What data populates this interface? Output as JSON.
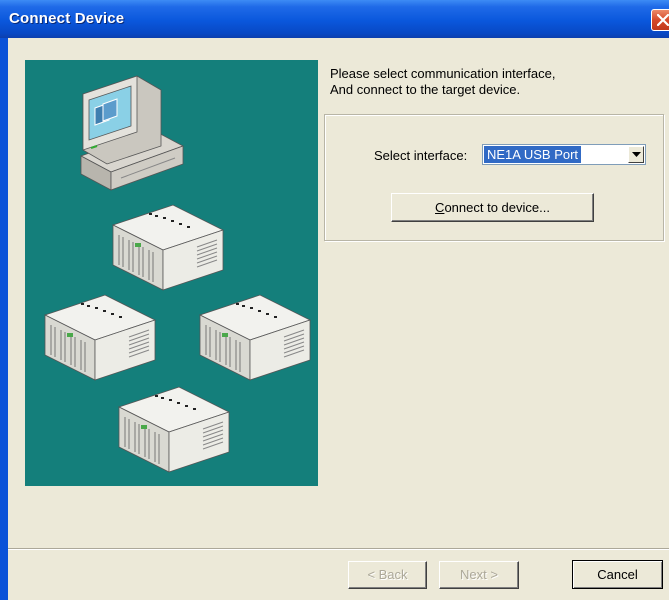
{
  "window": {
    "title": "Connect Device"
  },
  "instructions": {
    "line1": "Please select communication interface,",
    "line2": "And connect to the target device."
  },
  "interface": {
    "label": "Select interface:",
    "selected": "NE1A USB Port"
  },
  "buttons": {
    "connect_pre": "",
    "connect_mnemonic": "C",
    "connect_rest": "onnect to device...",
    "back": "< Back",
    "next": "Next >",
    "cancel": "Cancel"
  },
  "colors": {
    "title_bar": "#0a57dc",
    "dialog_face": "#ece9d8",
    "illustration_bg": "#147f7b",
    "selection": "#316ac5",
    "close_button": "#d6492a"
  },
  "icons": {
    "close": "close-icon",
    "dropdown": "chevron-down-icon",
    "computer": "computer-icon",
    "device": "plc-device-icon"
  }
}
